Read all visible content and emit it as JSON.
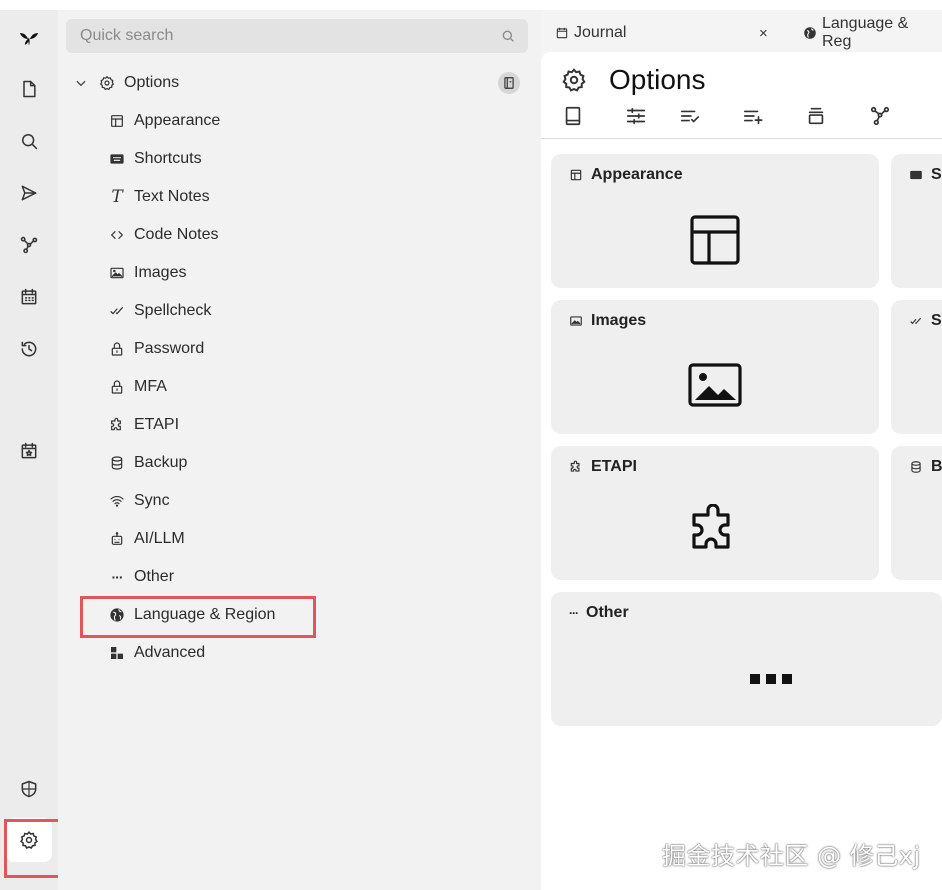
{
  "sidebar": {
    "search_placeholder": "Quick search",
    "root": {
      "label": "Options",
      "icon": "gear-icon",
      "expanded": true
    },
    "items": [
      {
        "label": "Appearance",
        "icon": "layout-icon"
      },
      {
        "label": "Shortcuts",
        "icon": "keyboard-icon"
      },
      {
        "label": "Text Notes",
        "icon": "text-icon"
      },
      {
        "label": "Code Notes",
        "icon": "code-icon"
      },
      {
        "label": "Images",
        "icon": "image-icon"
      },
      {
        "label": "Spellcheck",
        "icon": "check-double-icon"
      },
      {
        "label": "Password",
        "icon": "lock-icon"
      },
      {
        "label": "MFA",
        "icon": "lock-icon"
      },
      {
        "label": "ETAPI",
        "icon": "puzzle-icon"
      },
      {
        "label": "Backup",
        "icon": "database-icon"
      },
      {
        "label": "Sync",
        "icon": "wifi-icon"
      },
      {
        "label": "AI/LLM",
        "icon": "robot-icon"
      },
      {
        "label": "Other",
        "icon": "dots-icon"
      },
      {
        "label": "Language & Region",
        "icon": "globe-icon",
        "highlighted": true
      },
      {
        "label": "Advanced",
        "icon": "grid-icon"
      }
    ]
  },
  "tabs": [
    {
      "label": "Journal",
      "icon": "calendar-icon",
      "closable": true
    },
    {
      "label": "Language & Reg",
      "icon": "globe-icon"
    }
  ],
  "page": {
    "title": "Options",
    "cards": [
      {
        "label": "Appearance",
        "icon": "layout-icon"
      },
      {
        "label": "Images",
        "icon": "image-icon"
      },
      {
        "label": "ETAPI",
        "icon": "puzzle-icon"
      },
      {
        "label": "Other",
        "icon": "dots-icon"
      },
      {
        "label": "S",
        "icon": "keyboard-icon"
      },
      {
        "label": "S",
        "icon": "check-double-icon"
      },
      {
        "label": "B",
        "icon": "database-icon"
      }
    ]
  },
  "watermark": "掘金技术社区 @ 修己xj",
  "colors": {
    "highlight": "#e0575b",
    "rail_bg": "#ececec",
    "tree_bg": "#f2f2f2",
    "card_bg": "#efefef"
  }
}
